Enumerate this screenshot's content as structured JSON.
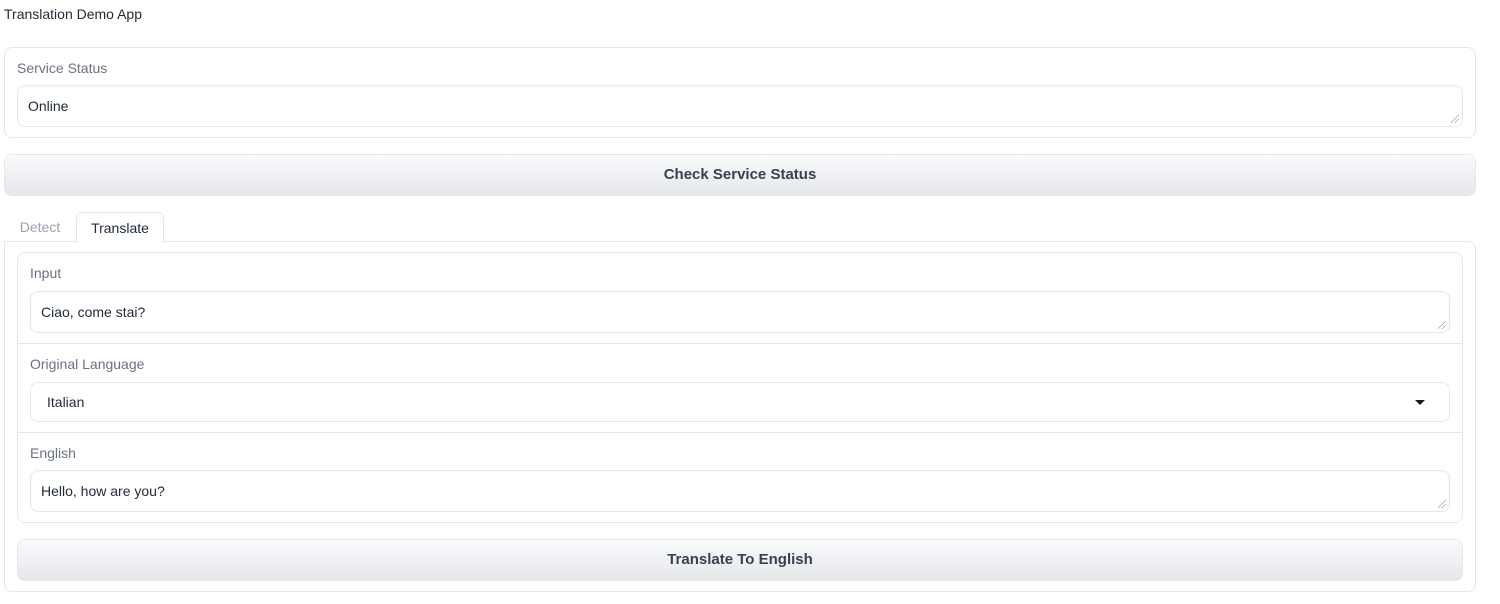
{
  "app": {
    "title": "Translation Demo App"
  },
  "status": {
    "label": "Service Status",
    "value": "Online",
    "check_button_label": "Check Service Status"
  },
  "tabs": [
    {
      "label": "Detect",
      "active": false
    },
    {
      "label": "Translate",
      "active": true
    }
  ],
  "translate": {
    "input_label": "Input",
    "input_value": "Ciao, come stai?",
    "language_label": "Original Language",
    "language_selected": "Italian",
    "output_label": "English",
    "output_value": "Hello, how are you?",
    "translate_button_label": "Translate To English"
  }
}
